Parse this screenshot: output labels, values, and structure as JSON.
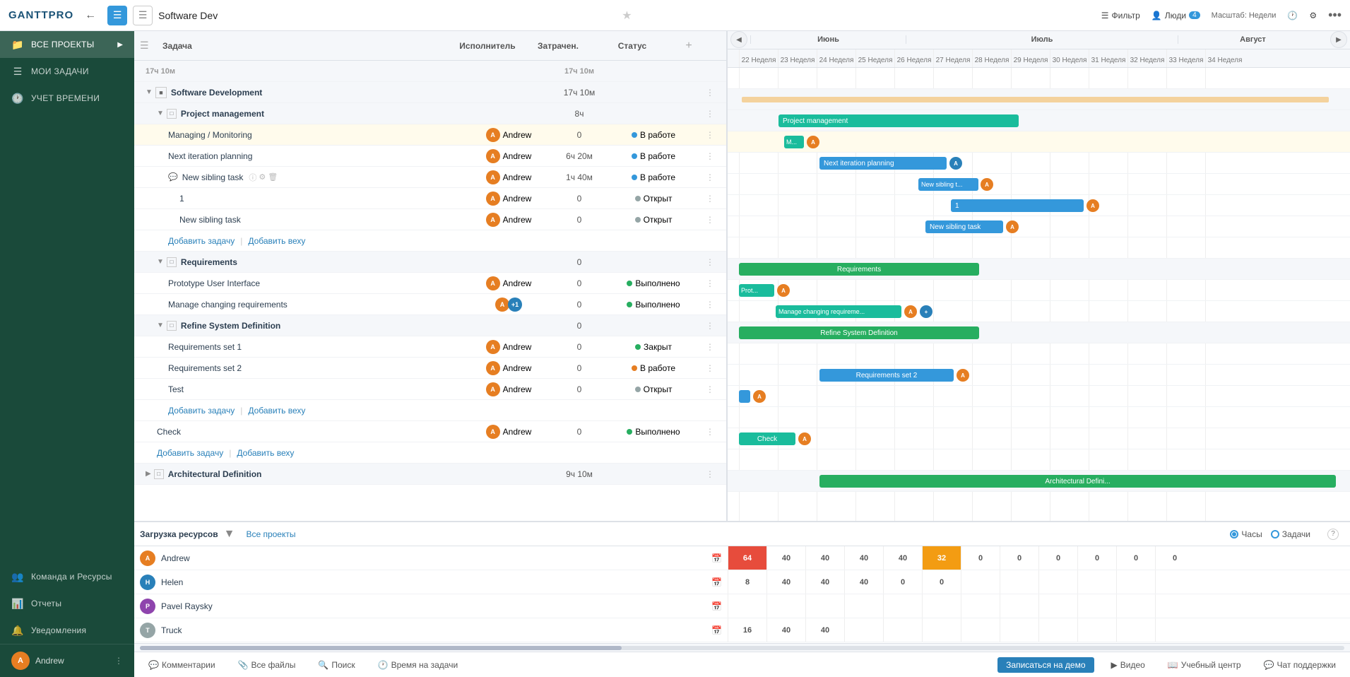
{
  "topbar": {
    "logo": "GANTTPRO",
    "project_title": "Software Dev",
    "scale": "Масштаб: Недели",
    "filter_label": "Фильтр",
    "people_label": "Люди",
    "people_count": "4",
    "more_label": "•••"
  },
  "sidebar": {
    "all_projects": "ВСЕ ПРОЕКТЫ",
    "my_tasks": "МОИ ЗАДАЧИ",
    "time_tracking": "УЧЕТ ВРЕМЕНИ",
    "team": "Команда и Ресурсы",
    "reports": "Отчеты",
    "notifications": "Уведомления",
    "user_name": "Andrew"
  },
  "table_headers": {
    "task": "Задача",
    "assignee": "Исполнитель",
    "spent": "Затрачен.",
    "status": "Статус"
  },
  "tasks": [
    {
      "id": "total",
      "indent": 0,
      "name": "17ч 10м",
      "spent": "17ч 10м",
      "type": "total"
    },
    {
      "id": "t1",
      "indent": 0,
      "name": "Software Development",
      "spent": "17ч 10м",
      "type": "group",
      "expand": true
    },
    {
      "id": "t2",
      "indent": 1,
      "name": "Project management",
      "spent": "8ч",
      "type": "group",
      "expand": true
    },
    {
      "id": "t3",
      "indent": 2,
      "name": "Managing / Monitoring",
      "assignee": "Andrew",
      "spent": "0",
      "status": "В работе",
      "status_type": "blue"
    },
    {
      "id": "t4",
      "indent": 2,
      "name": "Next iteration planning",
      "assignee": "Andrew",
      "spent": "6ч 20м",
      "status": "В работе",
      "status_type": "blue"
    },
    {
      "id": "t5",
      "indent": 2,
      "name": "New sibling task",
      "assignee": "Andrew",
      "spent": "1ч 40м",
      "status": "В работе",
      "status_type": "blue",
      "has_comment": true
    },
    {
      "id": "t6",
      "indent": 3,
      "name": "1",
      "assignee": "Andrew",
      "spent": "0",
      "status": "Открыт",
      "status_type": "gray"
    },
    {
      "id": "t7",
      "indent": 3,
      "name": "New sibling task",
      "assignee": "Andrew",
      "spent": "0",
      "status": "Открыт",
      "status_type": "gray"
    },
    {
      "id": "t8",
      "indent": 2,
      "name": "",
      "type": "add_links",
      "add_task": "Добавить задачу",
      "add_milestone": "Добавить веху"
    },
    {
      "id": "t9",
      "indent": 1,
      "name": "Requirements",
      "spent": "0",
      "type": "group",
      "expand": true
    },
    {
      "id": "t10",
      "indent": 2,
      "name": "Prototype User Interface",
      "assignee": "Andrew",
      "spent": "0",
      "status": "Выполнено",
      "status_type": "green"
    },
    {
      "id": "t11",
      "indent": 2,
      "name": "Manage changing requirements",
      "assignee": "multi",
      "spent": "0",
      "status": "Выполнено",
      "status_type": "green"
    },
    {
      "id": "t12",
      "indent": 1,
      "name": "Refine System Definition",
      "spent": "0",
      "type": "group",
      "expand": true
    },
    {
      "id": "t13",
      "indent": 2,
      "name": "Requirements set 1",
      "assignee": "Andrew",
      "spent": "0",
      "status": "Закрыт",
      "status_type": "green"
    },
    {
      "id": "t14",
      "indent": 2,
      "name": "Requirements set 2",
      "assignee": "Andrew",
      "spent": "0",
      "status": "В работе",
      "status_type": "orange"
    },
    {
      "id": "t15",
      "indent": 2,
      "name": "Test",
      "assignee": "Andrew",
      "spent": "0",
      "status": "Открыт",
      "status_type": "gray"
    },
    {
      "id": "t16",
      "indent": 2,
      "name": "",
      "type": "add_links",
      "add_task": "Добавить задачу",
      "add_milestone": "Добавить веху"
    },
    {
      "id": "t17",
      "indent": 1,
      "name": "Check",
      "assignee": "Andrew",
      "spent": "0",
      "status": "Выполнено",
      "status_type": "green"
    },
    {
      "id": "t18",
      "indent": 1,
      "name": "",
      "type": "add_links",
      "add_task": "Добавить задачу",
      "add_milestone": "Добавить веху"
    },
    {
      "id": "t19",
      "indent": 0,
      "name": "Architectural Definition",
      "spent": "9ч 10м",
      "type": "group",
      "expand": false
    }
  ],
  "gantt_months": [
    "Июнь",
    "Июль",
    "Август"
  ],
  "gantt_weeks": [
    "23 Неделя",
    "24 Неделя",
    "25 Неделя",
    "26 Неделя",
    "27 Неделя",
    "28 Неделя",
    "29 Неделя",
    "30 Неделя",
    "31 Неделя",
    "32 Неделя",
    "33 Неделя",
    "34 Неделя"
  ],
  "resource_panel": {
    "label": "Загрузка ресурсов",
    "all_projects": "Все проекты",
    "hours_label": "Часы",
    "tasks_label": "Задачи"
  },
  "resources": [
    {
      "name": "Andrew",
      "avatar_color": "orange",
      "cells": [
        "64",
        "40",
        "40",
        "40",
        "40",
        "32",
        "0",
        "0",
        "0",
        "0",
        "0",
        "0"
      ],
      "cell_types": [
        "red",
        "normal",
        "normal",
        "normal",
        "normal",
        "orange",
        "normal",
        "normal",
        "normal",
        "normal",
        "normal",
        "normal"
      ]
    },
    {
      "name": "Helen",
      "avatar_color": "blue",
      "cells": [
        "8",
        "40",
        "40",
        "40",
        "0",
        "0",
        "",
        "",
        "",
        "",
        "",
        ""
      ],
      "cell_types": [
        "normal",
        "normal",
        "normal",
        "normal",
        "normal",
        "normal",
        "",
        "",
        "",
        "",
        "",
        ""
      ]
    },
    {
      "name": "Pavel Raysky",
      "avatar_color": "purple",
      "cells": [
        "",
        "",
        "",
        "",
        "",
        "",
        "",
        "",
        "",
        "",
        "",
        ""
      ],
      "cell_types": []
    },
    {
      "name": "Truck",
      "avatar_color": "gray",
      "cells": [
        "16",
        "40",
        "40",
        "",
        "",
        "",
        "",
        "",
        "",
        "",
        "",
        ""
      ],
      "cell_types": [
        "normal",
        "normal",
        "normal",
        "",
        "",
        "",
        "",
        "",
        "",
        "",
        "",
        ""
      ]
    }
  ],
  "bottom": {
    "comments": "Комментарии",
    "files": "Все файлы",
    "search": "Поиск",
    "time": "Время на задачи",
    "demo": "Записаться на демо",
    "video": "Видео",
    "tutorial": "Учебный центр",
    "support": "Чат поддержки"
  }
}
